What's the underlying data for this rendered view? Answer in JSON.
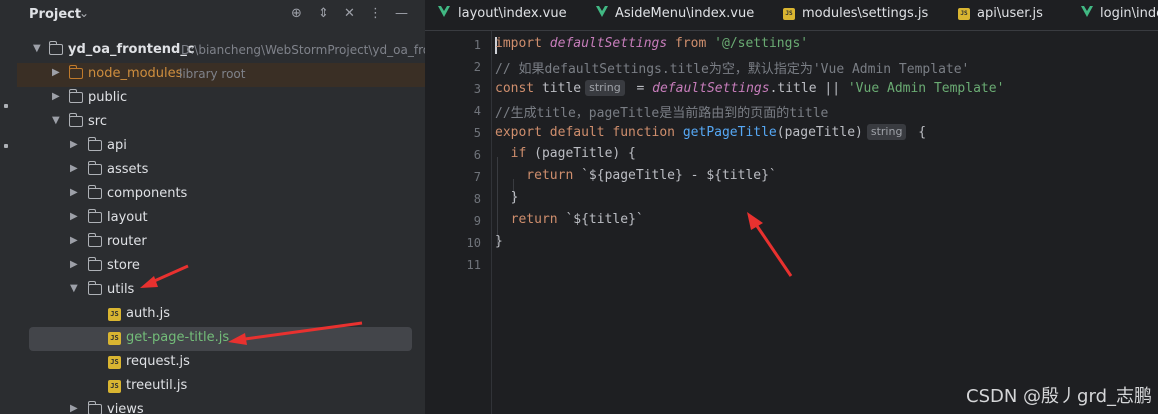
{
  "sidebar": {
    "title": "Project",
    "tree": [
      {
        "label": "yd_oa_frontend_c",
        "path": "D:\\biancheng\\WebStormProject\\yd_oa_fro"
      },
      {
        "label": "node_modules",
        "note": "library root"
      },
      {
        "label": "public"
      },
      {
        "label": "src"
      },
      {
        "label": "api"
      },
      {
        "label": "assets"
      },
      {
        "label": "components"
      },
      {
        "label": "layout"
      },
      {
        "label": "router"
      },
      {
        "label": "store"
      },
      {
        "label": "utils"
      },
      {
        "label": "auth.js"
      },
      {
        "label": "get-page-title.js"
      },
      {
        "label": "request.js"
      },
      {
        "label": "treeutil.js"
      },
      {
        "label": "views"
      }
    ]
  },
  "tabs": [
    {
      "label": "layout\\index.vue",
      "icon": "vue"
    },
    {
      "label": "AsideMenu\\index.vue",
      "icon": "vue"
    },
    {
      "label": "modules\\settings.js",
      "icon": "js"
    },
    {
      "label": "api\\user.js",
      "icon": "js"
    },
    {
      "label": "login\\index",
      "icon": "vue"
    }
  ],
  "editor": {
    "line_numbers": [
      "1",
      "2",
      "3",
      "4",
      "5",
      "6",
      "7",
      "8",
      "9",
      "10",
      "11"
    ],
    "lines": [
      [
        {
          "t": "import ",
          "c": "kw"
        },
        {
          "t": "defaultSettings",
          "c": "it"
        },
        {
          "t": " from ",
          "c": "kw"
        },
        {
          "t": "'@/settings'",
          "c": "str"
        }
      ],
      [
        {
          "t": "// 如果defaultSettings.title为空，默认指定为'Vue Admin Template'",
          "c": "cm"
        }
      ],
      [
        {
          "t": "const ",
          "c": "kw"
        },
        {
          "t": "title",
          "c": ""
        },
        {
          "hint": "string"
        },
        {
          "t": " = ",
          "c": ""
        },
        {
          "t": "defaultSettings",
          "c": "it"
        },
        {
          "t": ".title || ",
          "c": ""
        },
        {
          "t": "'Vue Admin Template'",
          "c": "str"
        }
      ],
      [
        {
          "t": "//生成title，pageTitle是当前路由到的页面的title",
          "c": "cm"
        }
      ],
      [
        {
          "t": "export default function ",
          "c": "kw"
        },
        {
          "t": "getPageTitle",
          "c": "fn"
        },
        {
          "t": "(pageTitle)",
          "c": ""
        },
        {
          "hint": "string"
        },
        {
          "t": " {",
          "c": ""
        }
      ],
      [
        {
          "t": "  if ",
          "c": "kw"
        },
        {
          "t": "(pageTitle) {",
          "c": ""
        }
      ],
      [
        {
          "t": "    return ",
          "c": "kw"
        },
        {
          "t": "`${pageTitle} - ${title}`",
          "c": ""
        }
      ],
      [
        {
          "t": "  }",
          "c": ""
        }
      ],
      [
        {
          "t": "  return ",
          "c": "kw"
        },
        {
          "t": "`${title}`",
          "c": ""
        }
      ],
      [
        {
          "t": "}",
          "c": ""
        }
      ],
      []
    ]
  },
  "watermark": "CSDN @殷丿grd_志鹏",
  "colors": {
    "annotation_arrow": "#e8312f",
    "highlight": "#3a2f25",
    "accent_green": "#73bd79"
  }
}
